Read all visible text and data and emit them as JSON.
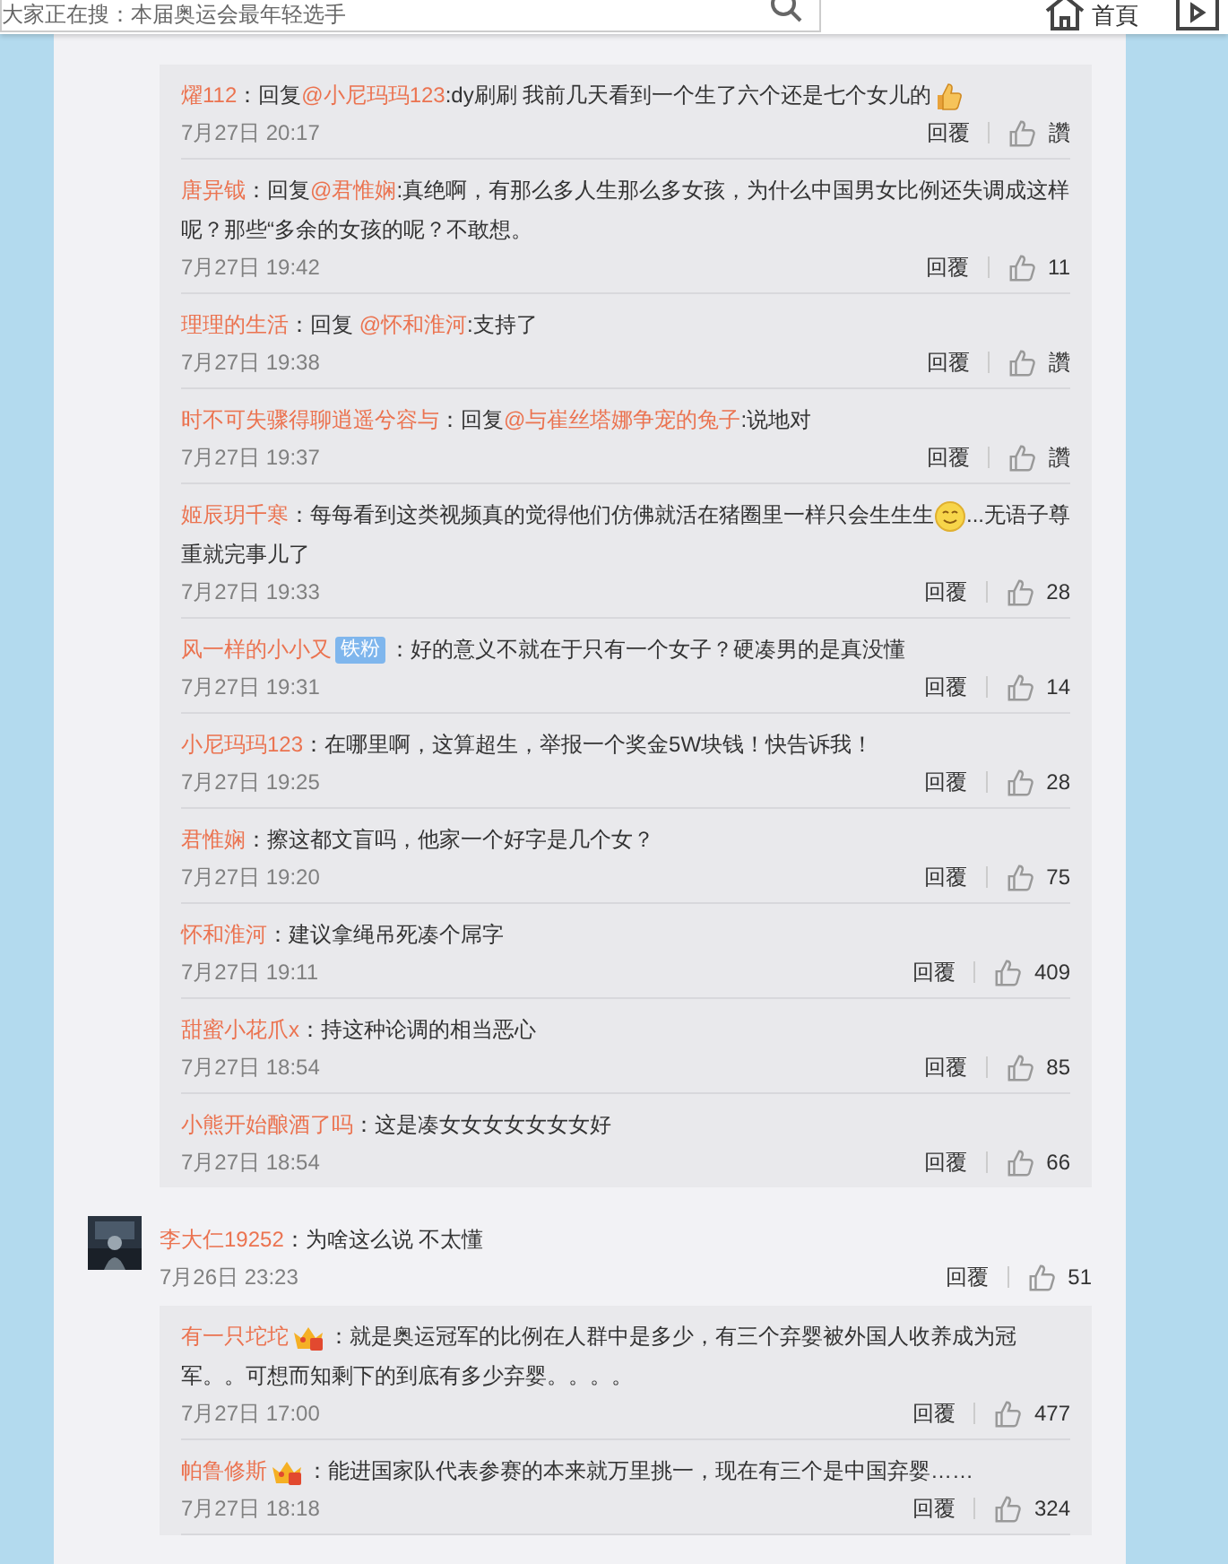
{
  "header": {
    "search": {
      "placeholder": "大家正在搜：本届奥运会最年轻选手"
    },
    "nav": [
      {
        "kind": "home",
        "label": "首頁"
      },
      {
        "kind": "video"
      }
    ]
  },
  "thread_top": {
    "replies": [
      {
        "user": "燿112",
        "sep": "：",
        "reply_prefix": "回复",
        "mention": "@小尼玛玛123",
        "text": ":dy刷刷 我前几天看到一个生了六个还是七个女儿的",
        "emoji": {
          "kind": "thumb"
        },
        "time": "7月27日 20:17",
        "reply_label": "回覆",
        "likes": "讚"
      },
      {
        "user": "唐异钺",
        "sep": "：",
        "reply_prefix": "回复",
        "mention": "@君惟娴",
        "text": ":真绝啊，有那么多人生那么多女孩，为什么中国男女比例还失调成这样呢？那些“多余的女孩的呢？不敢想。",
        "time": "7月27日 19:42",
        "reply_label": "回覆",
        "likes": "11"
      },
      {
        "user": "理理的生活",
        "sep": "：",
        "reply_prefix": "回复 ",
        "mention": "@怀和淮河",
        "text": ":支持了",
        "time": "7月27日 19:38",
        "reply_label": "回覆",
        "likes": "讚"
      },
      {
        "user": "时不可失骤得聊逍遥兮容与",
        "sep": "：",
        "reply_prefix": "回复",
        "mention": "@与崔丝塔娜争宠的兔子",
        "text": ":说地对",
        "time": "7月27日 19:37",
        "reply_label": "回覆",
        "likes": "讚"
      },
      {
        "user": "姬辰玥千寒",
        "sep": "：",
        "text": "每每看到这类视频真的觉得他们仿佛就活在猪圈里一样只会生生生",
        "emoji": {
          "kind": "smile"
        },
        "text_after": "...无语子尊重就完事儿了",
        "time": "7月27日 19:33",
        "reply_label": "回覆",
        "likes": "28"
      },
      {
        "user": "风一样的小小又",
        "badge": "铁粉",
        "sep": "：",
        "text": "好的意义不就在于只有一个女子？硬凑男的是真没懂",
        "time": "7月27日 19:31",
        "reply_label": "回覆",
        "likes": "14"
      },
      {
        "user": "小尼玛玛123",
        "sep": "：",
        "text": "在哪里啊，这算超生，举报一个奖金5W块钱！快告诉我！",
        "time": "7月27日 19:25",
        "reply_label": "回覆",
        "likes": "28"
      },
      {
        "user": "君惟娴",
        "sep": "：",
        "text": "擦这都文盲吗，他家一个好字是几个女？",
        "time": "7月27日 19:20",
        "reply_label": "回覆",
        "likes": "75"
      },
      {
        "user": "怀和淮河",
        "sep": "：",
        "text": "建议拿绳吊死凑个屌字",
        "time": "7月27日 19:11",
        "reply_label": "回覆",
        "likes": "409"
      },
      {
        "user": "甜蜜小花爪x",
        "sep": "：",
        "text": "持这种论调的相当恶心",
        "time": "7月27日 18:54",
        "reply_label": "回覆",
        "likes": "85"
      },
      {
        "user": "小熊开始酿酒了吗",
        "sep": "：",
        "text": "这是凑女女女女女女女好",
        "time": "7月27日 18:54",
        "reply_label": "回覆",
        "likes": "66"
      }
    ]
  },
  "comment": {
    "user": "李大仁19252",
    "sep": "：",
    "text": "为啥这么说 不太懂",
    "time": "7月26日 23:23",
    "reply_label": "回覆",
    "likes": "51",
    "replies": [
      {
        "user": "有一只坨坨",
        "vip": {
          "kind": "crown"
        },
        "sep": "：",
        "text": "就是奥运冠军的比例在人群中是多少，有三个弃婴被外国人收养成为冠军。。可想而知剩下的到底有多少弃婴。。。。",
        "time": "7月27日 17:00",
        "reply_label": "回覆",
        "likes": "477"
      },
      {
        "user": "帕鲁修斯",
        "vip": {
          "kind": "crown"
        },
        "sep": "：",
        "text": "能进国家队代表参赛的本来就万里挑一，现在有三个是中国弃婴……",
        "time": "7月27日 18:18",
        "reply_label": "回覆",
        "likes": "324"
      }
    ]
  }
}
